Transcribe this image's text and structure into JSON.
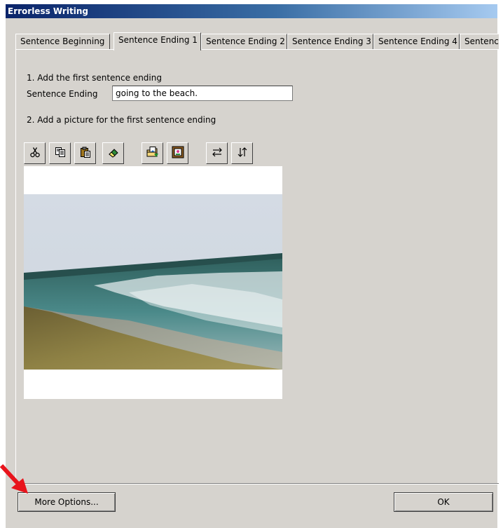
{
  "window": {
    "title": "Errorless Writing"
  },
  "tabs": [
    {
      "label": "Sentence Beginning"
    },
    {
      "label": "Sentence Ending 1",
      "active": true
    },
    {
      "label": "Sentence Ending 2"
    },
    {
      "label": "Sentence Ending 3"
    },
    {
      "label": "Sentence Ending 4"
    },
    {
      "label": "Sentenc"
    }
  ],
  "step1": {
    "heading": "1. Add the first sentence ending",
    "field_label": "Sentence Ending",
    "field_value": "going to the beach."
  },
  "step2": {
    "heading": "2. Add a picture for the first sentence ending"
  },
  "toolbar": {
    "buttons": [
      {
        "icon": "scissors-icon",
        "action": "cut"
      },
      {
        "icon": "copy-icon",
        "action": "copy"
      },
      {
        "icon": "paste-icon",
        "action": "paste"
      },
      {
        "icon": "eraser-icon",
        "action": "clear"
      },
      {
        "icon": "open-picture-icon",
        "action": "open"
      },
      {
        "icon": "picture-frame-icon",
        "action": "frame"
      },
      {
        "icon": "flip-horizontal-icon",
        "action": "flip-horizontal"
      },
      {
        "icon": "flip-vertical-icon",
        "action": "flip-vertical"
      }
    ]
  },
  "footer": {
    "more_options_label": "More Options...",
    "ok_label": "OK"
  },
  "colors": {
    "face": "#d6d3ce",
    "title_start": "#0a246a",
    "title_end": "#a6caf0",
    "arrow": "#e8141c"
  }
}
